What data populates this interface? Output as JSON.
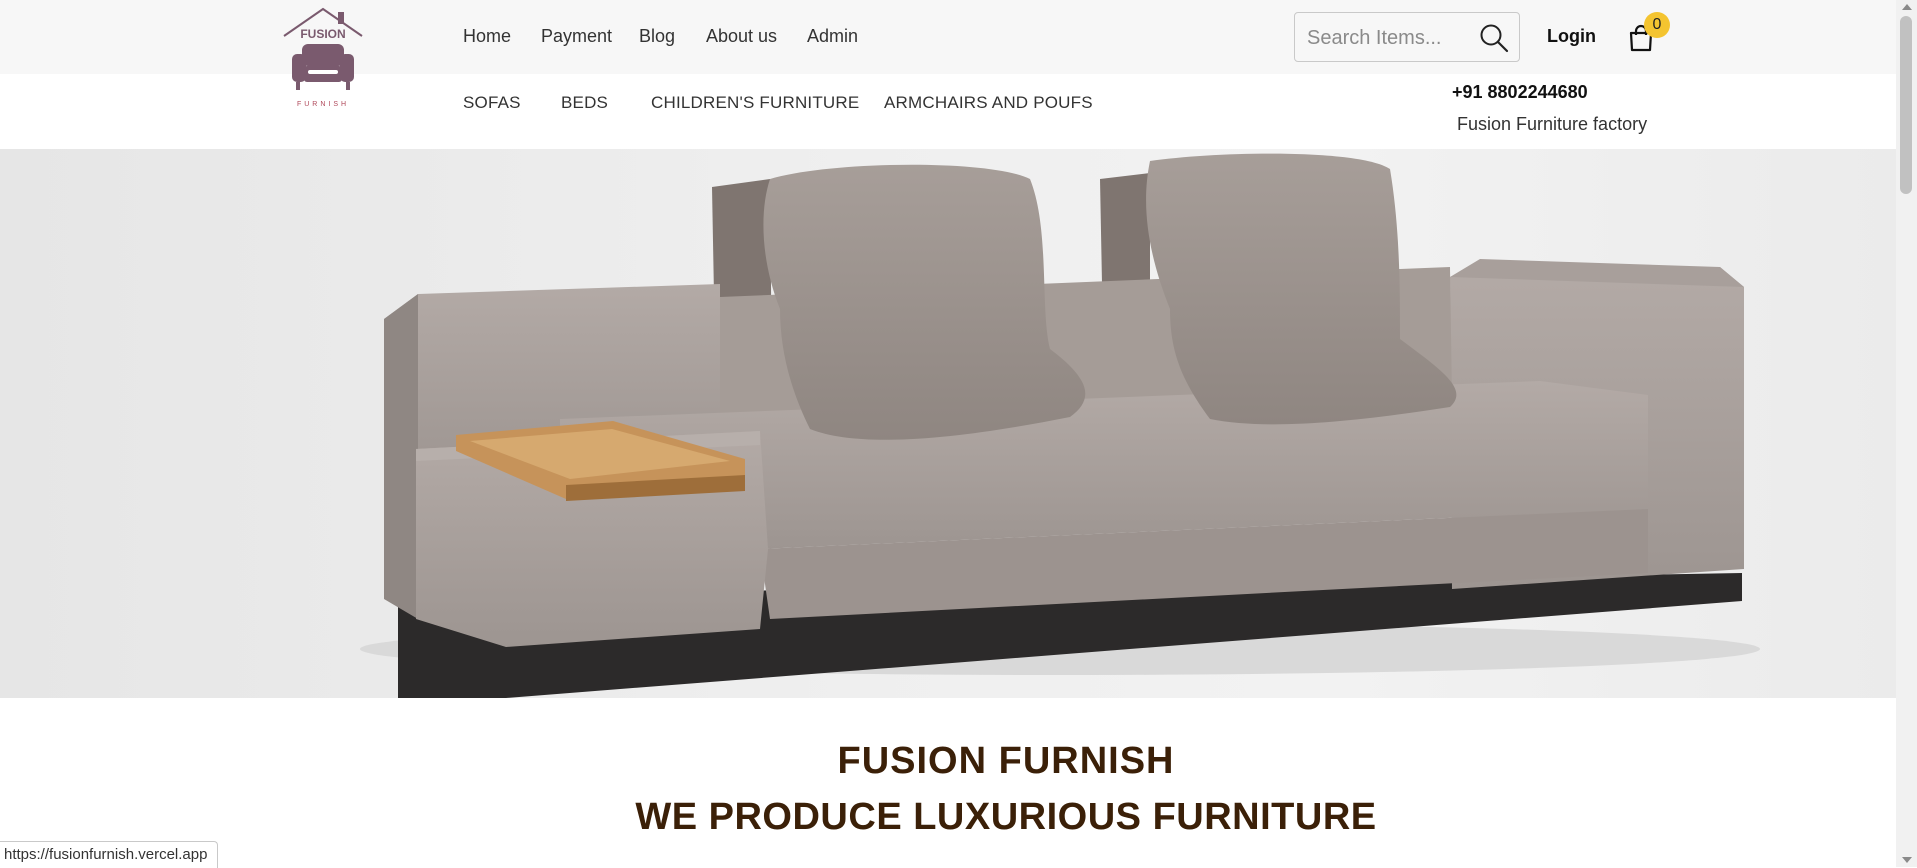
{
  "brand": {
    "logo_top": "FUSION",
    "logo_bottom": "FURNISH"
  },
  "nav": {
    "items": [
      "Home",
      "Payment",
      "Blog",
      "About us",
      "Admin"
    ]
  },
  "categories": {
    "items": [
      "SOFAS",
      "BEDS",
      "CHILDREN'S FURNITURE",
      "ARMCHAIRS AND POUFS"
    ]
  },
  "search": {
    "placeholder": "Search Items...",
    "value": ""
  },
  "header": {
    "login_label": "Login",
    "cart_count": "0",
    "phone": "+91 8802244680",
    "factory": "Fusion Furniture factory"
  },
  "hero": {
    "title": "FUSION FURNISH",
    "subtitle": "WE PRODUCE LUXURIOUS FURNITURE"
  },
  "status_bar": {
    "url": "https://fusionfurnish.vercel.app"
  },
  "colors": {
    "topbar": "#f7f7f7",
    "title": "#3b2008",
    "badge": "#f4c430",
    "logo": "#7a5a6e"
  }
}
